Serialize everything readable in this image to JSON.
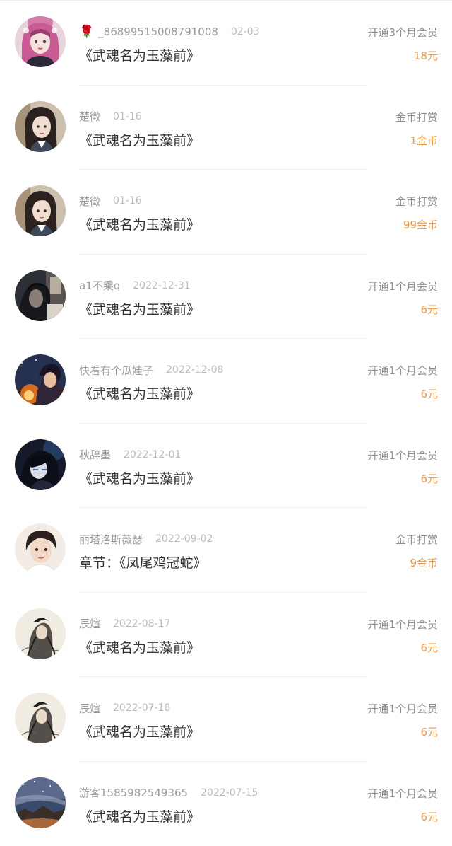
{
  "records": [
    {
      "avatar": "avatar-girl-pink-hair",
      "rose": true,
      "name": "_86899515008791008",
      "date": "02-03",
      "title": "《武魂名为玉藻前》",
      "type": "开通3个月会员",
      "amount": "18元"
    },
    {
      "avatar": "avatar-girl-dark-hair",
      "rose": false,
      "name": "楚徵",
      "date": "01-16",
      "title": "《武魂名为玉藻前》",
      "type": "金币打赏",
      "amount": "1金币"
    },
    {
      "avatar": "avatar-girl-dark-hair",
      "rose": false,
      "name": "楚徵",
      "date": "01-16",
      "title": "《武魂名为玉藻前》",
      "type": "金币打赏",
      "amount": "99金币"
    },
    {
      "avatar": "avatar-person-dark",
      "rose": false,
      "name": "a1不乘q",
      "date": "2022-12-31",
      "title": "《武魂名为玉藻前》",
      "type": "开通1个月会员",
      "amount": "6元"
    },
    {
      "avatar": "avatar-anime-fire-night",
      "rose": false,
      "name": "快看有个瓜娃子",
      "date": "2022-12-08",
      "title": "《武魂名为玉藻前》",
      "type": "开通1个月会员",
      "amount": "6元"
    },
    {
      "avatar": "avatar-anime-dark-boy",
      "rose": false,
      "name": "秋辞墨",
      "date": "2022-12-01",
      "title": "《武魂名为玉藻前》",
      "type": "开通1个月会员",
      "amount": "6元"
    },
    {
      "avatar": "avatar-young-man",
      "rose": false,
      "name": "丽塔洛斯薇瑟",
      "date": "2022-09-02",
      "title": "章节：《凤尾鸡冠蛇》",
      "type": "金币打赏",
      "amount": "9金币"
    },
    {
      "avatar": "avatar-ink-painting",
      "rose": false,
      "name": "辰煊",
      "date": "2022-08-17",
      "title": "《武魂名为玉藻前》",
      "type": "开通1个月会员",
      "amount": "6元"
    },
    {
      "avatar": "avatar-ink-painting",
      "rose": false,
      "name": "辰煊",
      "date": "2022-07-18",
      "title": "《武魂名为玉藻前》",
      "type": "开通1个月会员",
      "amount": "6元"
    },
    {
      "avatar": "avatar-night-sky",
      "rose": false,
      "name": "游客1585982549365",
      "date": "2022-07-15",
      "title": "《武魂名为玉藻前》",
      "type": "开通1个月会员",
      "amount": "6元"
    }
  ],
  "colors": {
    "amount": "#e69a47",
    "name": "#9a9a9a",
    "date": "#bbbbbb",
    "title": "#333333",
    "type": "#8e8e8e"
  }
}
